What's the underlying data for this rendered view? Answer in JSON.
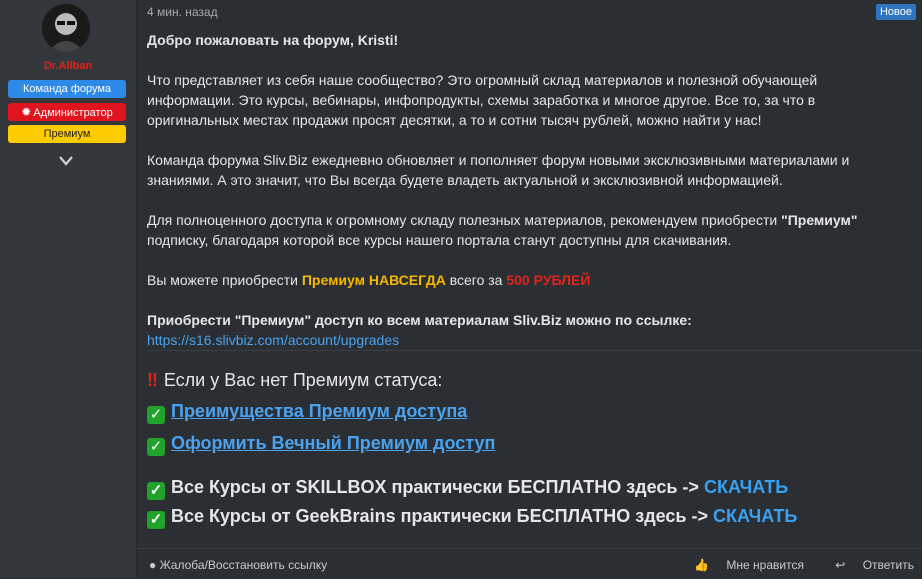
{
  "author": {
    "username": "Dr.Allban",
    "badges": [
      "Команда форума",
      "Администратор",
      "Премиум"
    ]
  },
  "post": {
    "time": "4 мин. назад",
    "new_label": "Новое",
    "greeting": "Добро пожаловать на форум, Kristi!",
    "p1": "Что представляет из себя наше сообщество? Это огромный склад материалов и полезной обучающей информации. Это курсы, вебинары, инфопродукты, схемы заработка и многое другое. Все то, за что в оригинальных местах продажи просят десятки, а то и сотни тысяч рублей, можно найти у нас!",
    "p2": "Команда форума Sliv.Biz ежедневно обновляет и пополняет форум новыми эксклюзивными материалами и знаниями. А это значит, что Вы всегда будете владеть актуальной и эксклюзивной информацией.",
    "p3a": "Для полноценного доступа к огромному складу полезных материалов, рекомендуем приобрести ",
    "p3b": "\"Премиум\"",
    "p3c": " подписку, благодаря которой все курсы нашего портала станут доступны для скачивания.",
    "p4a": "Вы можете приобрести ",
    "p4b": "Премиум НАВСЕГДА",
    "p4c": " всего за ",
    "p4d": "500 РУБЛЕЙ",
    "p5": "Приобрести \"Премиум\" доступ ко всем материалам Sliv.Biz можно по ссылке:",
    "p5link": "https://s16.slivbiz.com/account/upgrades",
    "e1": "Если у Вас нет Премиум статуса:",
    "e2": "Преимущества Премиум доступа",
    "e3": "Оформить Вечный Премиум доступ",
    "e4a": "Все Курсы от SKILLBOX практически БЕСПЛАТНО здесь -> ",
    "e4b": "СКАЧАТЬ",
    "e5a": "Все Курсы от GeekBrains практически БЕСПЛАТНО здесь -> ",
    "e5b": "СКАЧАТЬ"
  },
  "footer": {
    "report": "Жалоба/Восстановить ссылку",
    "like": "Мне нравится",
    "reply": "Ответить"
  },
  "colors": {
    "username": "#e2231a",
    "team_badge": "#2d8ae6",
    "admin_badge": "#e0141e",
    "premium_badge": "#ffcc00",
    "link": "#4aa3f0"
  }
}
